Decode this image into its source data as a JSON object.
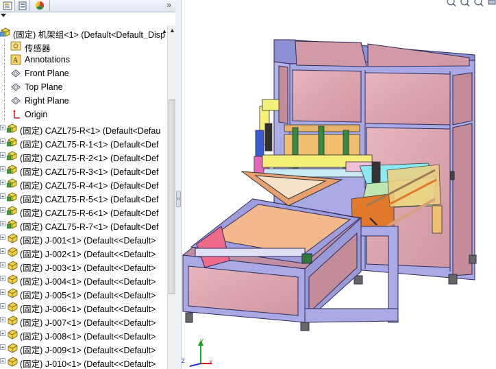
{
  "tree": {
    "root": "(固定) 机架组<1> (Default<Default_Disp",
    "items": [
      {
        "label": "传感器",
        "icon": "sensor-folder-icon",
        "indent": "child"
      },
      {
        "label": "Annotations",
        "icon": "annotations-icon",
        "indent": "child"
      },
      {
        "label": "Front Plane",
        "icon": "plane-icon",
        "indent": "child"
      },
      {
        "label": "Top Plane",
        "icon": "plane-icon",
        "indent": "child"
      },
      {
        "label": "Right Plane",
        "icon": "plane-icon",
        "indent": "child"
      },
      {
        "label": "Origin",
        "icon": "origin-icon",
        "indent": "child"
      },
      {
        "label": "(固定) CAZL75-R<1> (Default<Defau",
        "icon": "subassembly-icon",
        "indent": "root"
      },
      {
        "label": "(固定) CAZL75-R-1<1> (Default<Def",
        "icon": "subassembly-icon",
        "indent": "root"
      },
      {
        "label": "(固定) CAZL75-R-2<1> (Default<Def",
        "icon": "subassembly-icon",
        "indent": "root"
      },
      {
        "label": "(固定) CAZL75-R-3<1> (Default<Def",
        "icon": "subassembly-icon",
        "indent": "root"
      },
      {
        "label": "(固定) CAZL75-R-4<1> (Default<Def",
        "icon": "subassembly-icon",
        "indent": "root"
      },
      {
        "label": "(固定) CAZL75-R-5<1> (Default<Def",
        "icon": "subassembly-icon",
        "indent": "root"
      },
      {
        "label": "(固定) CAZL75-R-6<1> (Default<Def",
        "icon": "subassembly-icon",
        "indent": "root"
      },
      {
        "label": "(固定) CAZL75-R-7<1> (Default<Def",
        "icon": "subassembly-icon",
        "indent": "root"
      },
      {
        "label": "(固定) J-001<1> (Default<<Default>",
        "icon": "part-icon",
        "indent": "root"
      },
      {
        "label": "(固定) J-002<1> (Default<<Default>",
        "icon": "part-icon",
        "indent": "root"
      },
      {
        "label": "(固定) J-003<1> (Default<<Default>",
        "icon": "part-icon",
        "indent": "root"
      },
      {
        "label": "(固定) J-004<1> (Default<<Default>",
        "icon": "part-icon",
        "indent": "root"
      },
      {
        "label": "(固定) J-005<1> (Default<<Default>",
        "icon": "part-icon",
        "indent": "root"
      },
      {
        "label": "(固定) J-006<1> (Default<<Default>",
        "icon": "part-icon",
        "indent": "root"
      },
      {
        "label": "(固定) J-007<1> (Default<<Default>",
        "icon": "part-icon",
        "indent": "root"
      },
      {
        "label": "(固定) J-008<1> (Default<<Default>",
        "icon": "part-icon",
        "indent": "root"
      },
      {
        "label": "(固定) J-009<1> (Default<<Default>",
        "icon": "part-icon",
        "indent": "root"
      },
      {
        "label": "(固定) J-010<1> (Default<<Default>",
        "icon": "part-icon",
        "indent": "root"
      }
    ]
  },
  "panel": {
    "tab_icons": [
      "feature-manager-icon",
      "property-manager-icon",
      "display-manager-icon"
    ],
    "overflow_glyph": "»"
  },
  "triad": {
    "x": "X",
    "y": "Y",
    "z": "Z"
  },
  "colors": {
    "frame_blue": "#a9a9e6",
    "panel_pink": "#dba3ad",
    "table_peach": "#f3b88c",
    "accent_orange": "#e58a3c",
    "accent_yellow": "#f4f07a",
    "accent_green": "#2f7a3a"
  }
}
